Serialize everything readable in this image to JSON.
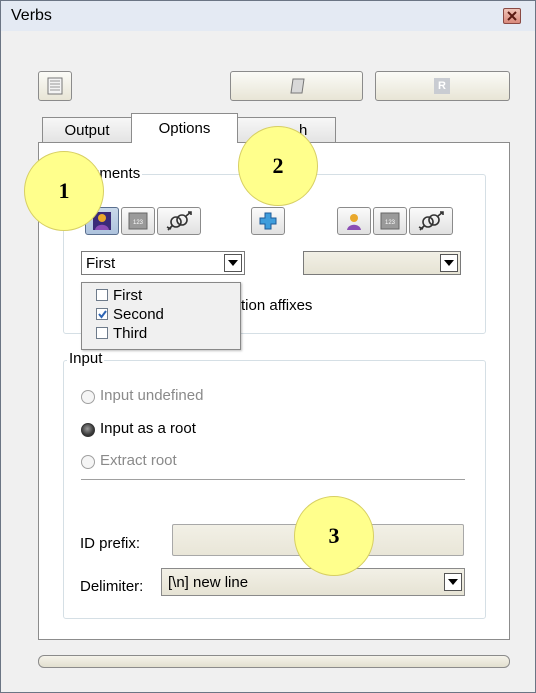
{
  "window": {
    "title": "Verbs"
  },
  "tabs": [
    {
      "label": "Output"
    },
    {
      "label": "Options"
    },
    {
      "label": "h"
    }
  ],
  "arguments": {
    "group_label": "uments",
    "left_select": {
      "value": "First"
    },
    "right_select": {
      "value": ""
    },
    "affixes_text": "tion affixes",
    "dropdown_items": [
      {
        "label": "First",
        "checked": false
      },
      {
        "label": "Second",
        "checked": true
      },
      {
        "label": "Third",
        "checked": false
      }
    ]
  },
  "input": {
    "group_label": "Input",
    "options": [
      {
        "label": "Input undefined",
        "enabled": false,
        "checked": false
      },
      {
        "label": "Input as a root",
        "enabled": true,
        "checked": true
      },
      {
        "label": "Extract root",
        "enabled": false,
        "checked": false
      }
    ],
    "id_prefix_label": "ID prefix:",
    "id_prefix_value": "",
    "delimiter_label": "Delimiter:",
    "delimiter_value": "[\\n] new line"
  },
  "toolbar": {
    "r_label": "R"
  },
  "annotations": [
    "1",
    "2",
    "3"
  ],
  "colors": {
    "badge_fill": "#ffff8c",
    "window_bg": "#f0f0f0",
    "pressed": "#aec3dd"
  }
}
